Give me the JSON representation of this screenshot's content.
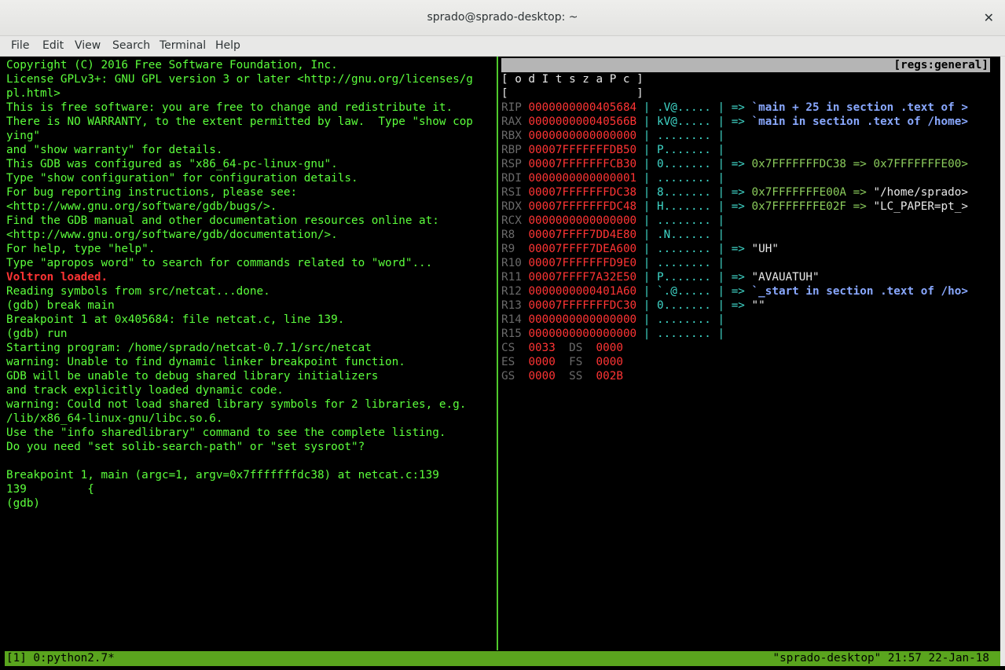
{
  "window": {
    "title": "sprado@sprado-desktop: ~"
  },
  "menu": [
    "File",
    "Edit",
    "View",
    "Search",
    "Terminal",
    "Help"
  ],
  "gdb": {
    "lines": [
      "Copyright (C) 2016 Free Software Foundation, Inc.",
      "License GPLv3+: GNU GPL version 3 or later <http://gnu.org/licenses/g",
      "pl.html>",
      "This is free software: you are free to change and redistribute it.",
      "There is NO WARRANTY, to the extent permitted by law.  Type \"show cop",
      "ying\"",
      "and \"show warranty\" for details.",
      "This GDB was configured as \"x86_64-pc-linux-gnu\".",
      "Type \"show configuration\" for configuration details.",
      "For bug reporting instructions, please see:",
      "<http://www.gnu.org/software/gdb/bugs/>.",
      "Find the GDB manual and other documentation resources online at:",
      "<http://www.gnu.org/software/gdb/documentation/>.",
      "For help, type \"help\".",
      "Type \"apropos word\" to search for commands related to \"word\"...",
      "Voltron loaded.",
      "Reading symbols from src/netcat...done.",
      "(gdb) break main",
      "Breakpoint 1 at 0x405684: file netcat.c, line 139.",
      "(gdb) run",
      "Starting program: /home/sprado/netcat-0.7.1/src/netcat",
      "warning: Unable to find dynamic linker breakpoint function.",
      "GDB will be unable to debug shared library initializers",
      "and track explicitly loaded dynamic code.",
      "warning: Could not load shared library symbols for 2 libraries, e.g.",
      "/lib/x86_64-linux-gnu/libc.so.6.",
      "Use the \"info sharedlibrary\" command to see the complete listing.",
      "Do you need \"set solib-search-path\" or \"set sysroot\"?",
      "",
      "Breakpoint 1, main (argc=1, argv=0x7fffffffdc38) at netcat.c:139",
      "139\t    {",
      "(gdb)"
    ],
    "highlight_line": 15
  },
  "regs": {
    "header": "[regs:general]",
    "flags_line": "[ o d I t s z a P c ]",
    "flags_line2": "[                   ]",
    "registers": [
      {
        "name": "RIP",
        "value": "0000000000405684",
        "ascii": ".V@.....",
        "deref": "`main + 25 in section .text of >",
        "deref_style": "blue"
      },
      {
        "name": "RAX",
        "value": "000000000040566B",
        "ascii": "kV@.....",
        "deref": "`main in section .text of /home>",
        "deref_style": "blue"
      },
      {
        "name": "RBX",
        "value": "0000000000000000",
        "ascii": "........",
        "deref": "",
        "deref_style": ""
      },
      {
        "name": "RBP",
        "value": "00007FFFFFFFDB50",
        "ascii": "P.......",
        "deref": "",
        "deref_style": ""
      },
      {
        "name": "RSP",
        "value": "00007FFFFFFFCB30",
        "ascii": "0.......",
        "deref": "0x7FFFFFFFDC38 => 0x7FFFFFFFE00>",
        "deref_style": "olive"
      },
      {
        "name": "RDI",
        "value": "0000000000000001",
        "ascii": "........",
        "deref": "",
        "deref_style": ""
      },
      {
        "name": "RSI",
        "value": "00007FFFFFFFDC38",
        "ascii": "8.......",
        "deref": "0x7FFFFFFFE00A => \"/home/sprado>",
        "deref_style": "olive-white"
      },
      {
        "name": "RDX",
        "value": "00007FFFFFFFDC48",
        "ascii": "H.......",
        "deref": "0x7FFFFFFFE02F => \"LC_PAPER=pt_>",
        "deref_style": "olive-white"
      },
      {
        "name": "RCX",
        "value": "0000000000000000",
        "ascii": "........",
        "deref": "",
        "deref_style": ""
      },
      {
        "name": "R8",
        "value": "00007FFFF7DD4E80",
        "ascii": ".N......",
        "deref": "",
        "deref_style": ""
      },
      {
        "name": "R9",
        "value": "00007FFFF7DEA600",
        "ascii": "........",
        "deref": "\"UH\"",
        "deref_style": "white"
      },
      {
        "name": "R10",
        "value": "00007FFFFFFFD9E0",
        "ascii": "........",
        "deref": "",
        "deref_style": ""
      },
      {
        "name": "R11",
        "value": "00007FFFF7A32E50",
        "ascii": "P.......",
        "deref": "\"AVAUATUH\"",
        "deref_style": "white"
      },
      {
        "name": "R12",
        "value": "0000000000401A60",
        "ascii": "`.@.....",
        "deref": "`_start in section .text of /ho>",
        "deref_style": "blue"
      },
      {
        "name": "R13",
        "value": "00007FFFFFFFDC30",
        "ascii": "0.......",
        "deref": "\"\"",
        "deref_style": "white"
      },
      {
        "name": "R14",
        "value": "0000000000000000",
        "ascii": "........",
        "deref": "",
        "deref_style": ""
      },
      {
        "name": "R15",
        "value": "0000000000000000",
        "ascii": "........",
        "deref": "",
        "deref_style": ""
      }
    ],
    "segments": [
      [
        {
          "name": "CS",
          "value": "0033"
        },
        {
          "name": "DS",
          "value": "0000"
        }
      ],
      [
        {
          "name": "ES",
          "value": "0000"
        },
        {
          "name": "FS",
          "value": "0000"
        }
      ],
      [
        {
          "name": "GS",
          "value": "0000"
        },
        {
          "name": "SS",
          "value": "002B"
        }
      ]
    ]
  },
  "status": {
    "left": "[1] 0:python2.7*",
    "right": "\"sprado-desktop\" 21:57 22-Jan-18"
  }
}
